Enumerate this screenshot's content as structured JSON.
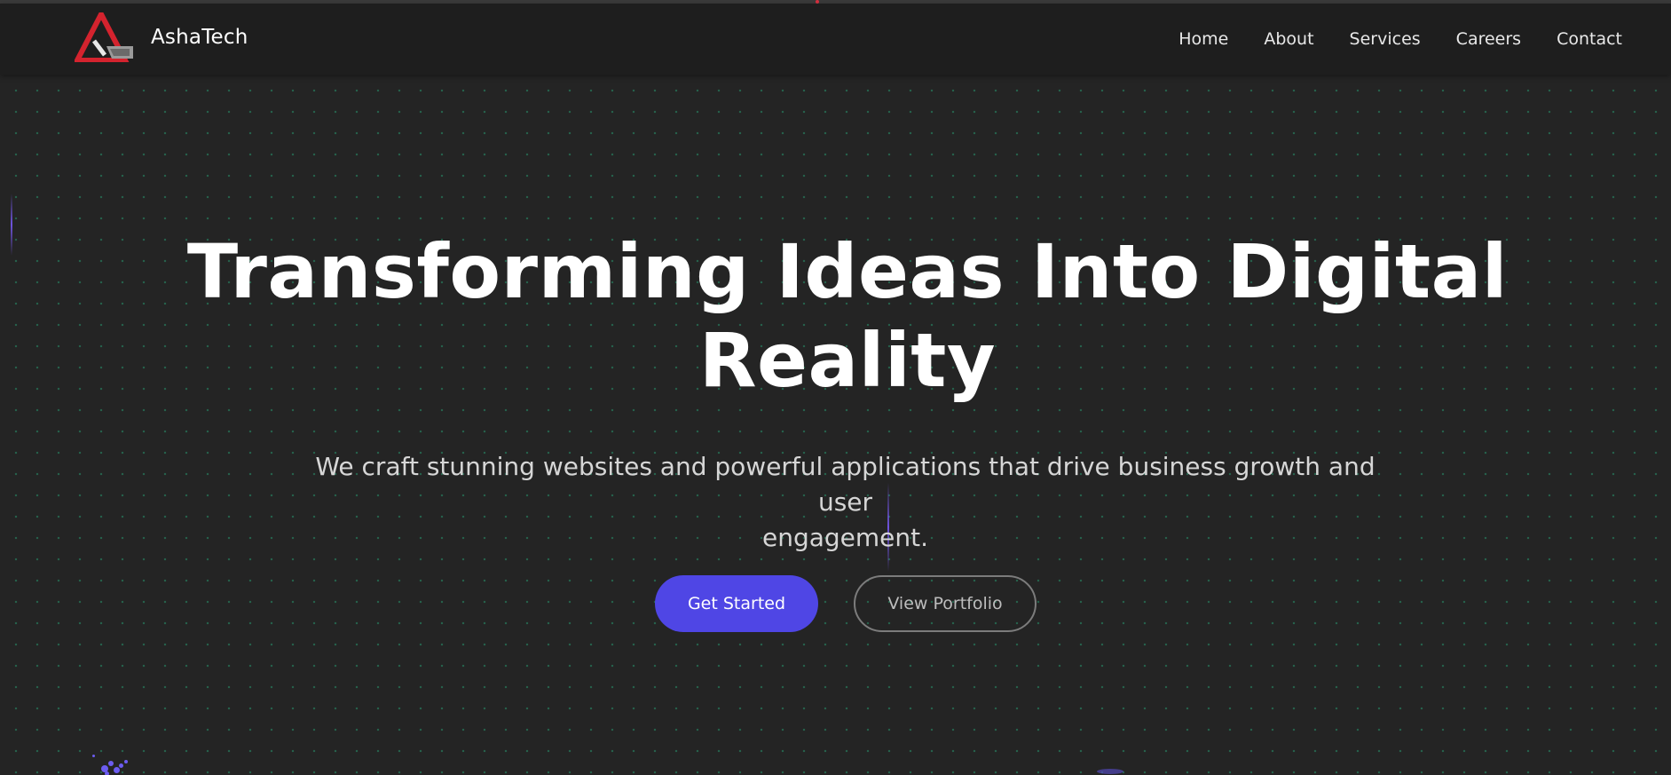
{
  "brand": {
    "name": "AshaTech",
    "logo_icon": "ashatech-triangle-logo-icon",
    "colors": {
      "logo_red": "#d4232e",
      "logo_gray": "#9a9a9a"
    }
  },
  "nav": {
    "links": [
      "Home",
      "About",
      "Services",
      "Careers",
      "Contact"
    ]
  },
  "hero": {
    "title_line1": "Transforming Ideas Into Digital",
    "title_line2": "Reality",
    "subtitle_line1": "We craft stunning websites and powerful applications that drive business growth and user",
    "subtitle_line2": "engagement.",
    "primary_button": "Get Started",
    "secondary_button": "View Portfolio"
  },
  "colors": {
    "background": "#242424",
    "navbar": "#1e1e1e",
    "accent": "#4f46e5",
    "dot_grid": "#28966e",
    "text": "#ffffff"
  }
}
